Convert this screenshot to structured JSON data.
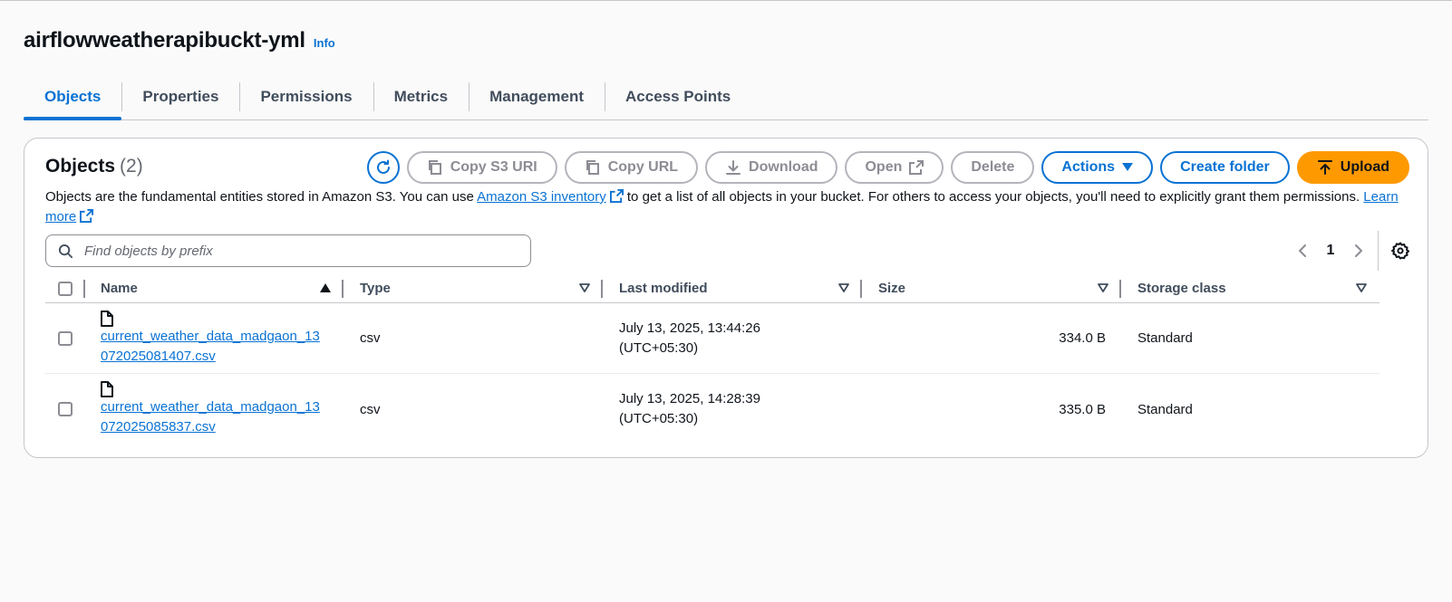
{
  "bucket": {
    "name": "airflowweatherapibuckt-yml",
    "info_label": "Info"
  },
  "tabs": [
    {
      "label": "Objects",
      "active": true
    },
    {
      "label": "Properties"
    },
    {
      "label": "Permissions"
    },
    {
      "label": "Metrics"
    },
    {
      "label": "Management"
    },
    {
      "label": "Access Points"
    }
  ],
  "objects_panel": {
    "title": "Objects",
    "count": "(2)",
    "toolbar": {
      "refresh_icon": "refresh-icon",
      "copy_s3_uri": "Copy S3 URI",
      "copy_url": "Copy URL",
      "download": "Download",
      "open": "Open",
      "delete": "Delete",
      "actions": "Actions",
      "create_folder": "Create folder",
      "upload": "Upload"
    },
    "description": {
      "part1": "Objects are the fundamental entities stored in Amazon S3. You can use ",
      "link1": "Amazon S3 inventory",
      "part2": " to get a list of all objects in your bucket. For others to access your objects, you'll need to explicitly grant them permissions. ",
      "link2": "Learn more"
    },
    "search": {
      "placeholder": "Find objects by prefix",
      "value": ""
    },
    "pagination": {
      "current_page": "1"
    }
  },
  "table": {
    "columns": [
      "Name",
      "Type",
      "Last modified",
      "Size",
      "Storage class"
    ],
    "rows": [
      {
        "name": "current_weather_data_madgaon_13072025081407.csv",
        "type": "csv",
        "last_modified_date": "July 13, 2025, 13:44:26",
        "last_modified_tz": "(UTC+05:30)",
        "size": "334.0 B",
        "storage_class": "Standard"
      },
      {
        "name": "current_weather_data_madgaon_13072025085837.csv",
        "type": "csv",
        "last_modified_date": "July 13, 2025, 14:28:39",
        "last_modified_tz": "(UTC+05:30)",
        "size": "335.0 B",
        "storage_class": "Standard"
      }
    ]
  },
  "colors": {
    "link": "#0972d3",
    "primary_button": "#ff9900",
    "border": "#c6c6cd"
  }
}
